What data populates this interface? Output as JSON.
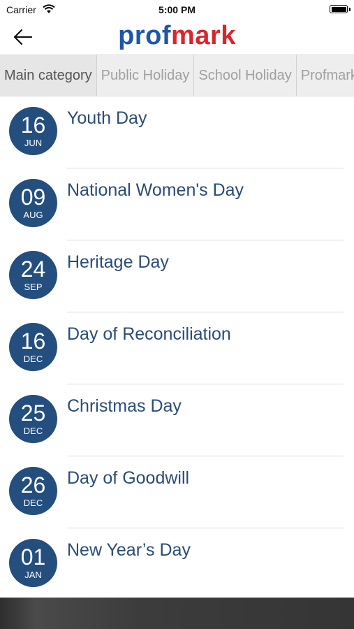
{
  "status_bar": {
    "carrier": "Carrier",
    "time": "5:00 PM"
  },
  "header": {
    "logo_part1": "prof",
    "logo_part2": "mark"
  },
  "colors": {
    "brand_blue": "#1f56a8",
    "brand_red": "#d9262b",
    "badge_bg": "#234e7e",
    "title_text": "#2a4c78"
  },
  "tabs": [
    {
      "label": "Main category"
    },
    {
      "label": "Public Holiday"
    },
    {
      "label": "School Holiday"
    },
    {
      "label": "Profmark"
    }
  ],
  "holidays": [
    {
      "day": "16",
      "month": "JUN",
      "title": "Youth Day"
    },
    {
      "day": "09",
      "month": "AUG",
      "title": "National Women's Day"
    },
    {
      "day": "24",
      "month": "SEP",
      "title": "Heritage Day"
    },
    {
      "day": "16",
      "month": "DEC",
      "title": "Day of Reconciliation"
    },
    {
      "day": "25",
      "month": "DEC",
      "title": "Christmas Day"
    },
    {
      "day": "26",
      "month": "DEC",
      "title": "Day of Goodwill"
    },
    {
      "day": "01",
      "month": "JAN",
      "title": "New Year’s Day"
    }
  ]
}
